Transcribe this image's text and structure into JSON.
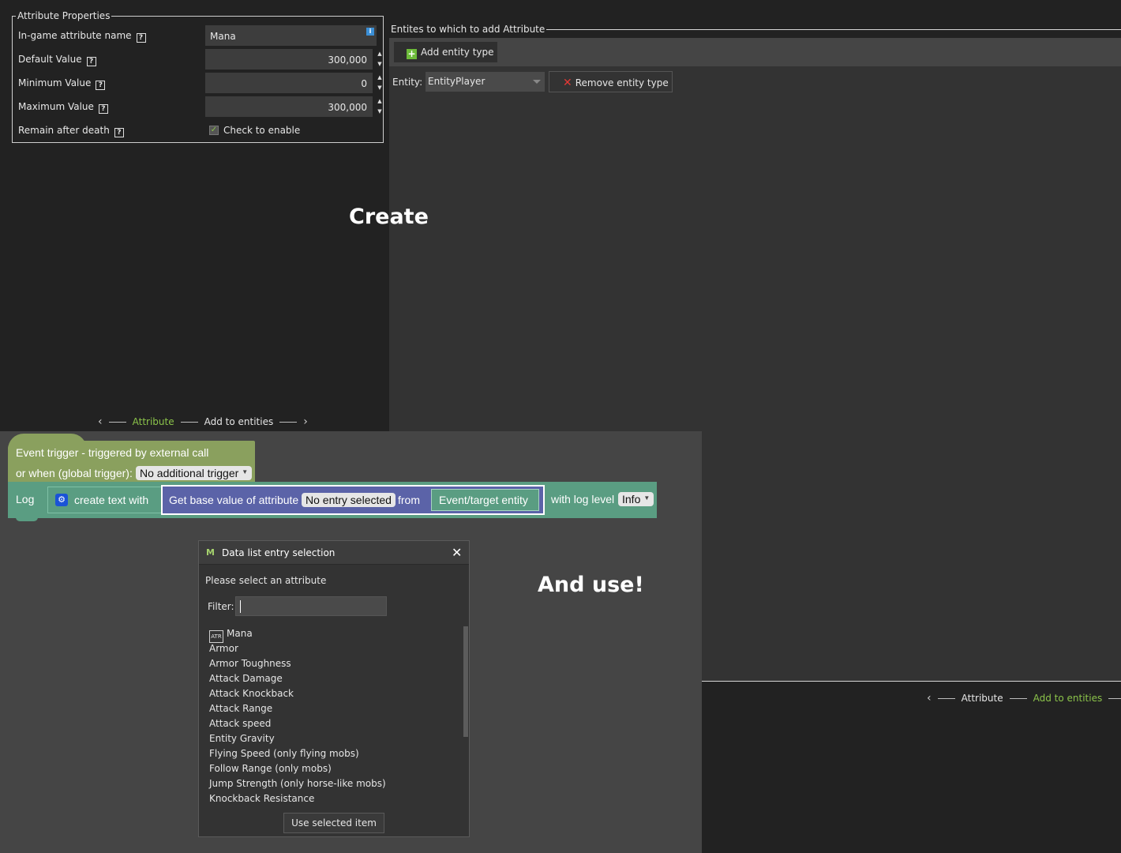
{
  "attribute_properties": {
    "legend": "Attribute Properties",
    "name_label": "In-game attribute name",
    "name_value": "Mana",
    "default_label": "Default Value",
    "default_value": "300,000",
    "min_label": "Minimum Value",
    "min_value": "0",
    "max_label": "Maximum Value",
    "max_value": "300,000",
    "remain_label": "Remain after death",
    "remain_checkbox_label": "Check to enable",
    "help_glyph": "?",
    "info_glyph": "i"
  },
  "wizard_nav_1": {
    "step1": "Attribute",
    "step2": "Add to entities",
    "active_step": "Attribute"
  },
  "wizard_nav_2": {
    "step1": "Attribute",
    "step2": "Add to entities",
    "active_step": "Add to entities"
  },
  "entities": {
    "header": "Entites to which to add Attribute",
    "add_button": "Add entity type",
    "entity_label": "Entity:",
    "entity_value": "EntityPlayer",
    "remove_button": "Remove entity type"
  },
  "captions": {
    "create": "Create",
    "use": "And use!"
  },
  "blockly": {
    "event_line1": "Event trigger - triggered by external call",
    "event_line2": "or when (global trigger):",
    "global_trigger_value": "No additional trigger",
    "log_label": "Log",
    "create_text": "create text with",
    "get_base": "Get base value of attribute",
    "attr_value": "No entry selected",
    "from_label": "from",
    "entity_value": "Event/target entity",
    "with_log_level": "with log level",
    "log_level_value": "Info"
  },
  "dialog": {
    "title": "Data list entry selection",
    "prompt": "Please select an attribute",
    "filter_label": "Filter:",
    "use_button": "Use selected item",
    "items": [
      "Mana",
      "Armor",
      "Armor Toughness",
      "Attack Damage",
      "Attack Knockback",
      "Attack Range",
      "Attack speed",
      "Entity Gravity",
      "Flying Speed (only flying mobs)",
      "Follow Range (only mobs)",
      "Jump Strength (only horse-like mobs)",
      "Knockback Resistance"
    ]
  },
  "colors": {
    "accent_green": "#8bc34a",
    "event_block": "#8aa05e",
    "log_block": "#5a9d82",
    "attribute_block": "#5b63a8",
    "remove_icon": "#e53935"
  }
}
